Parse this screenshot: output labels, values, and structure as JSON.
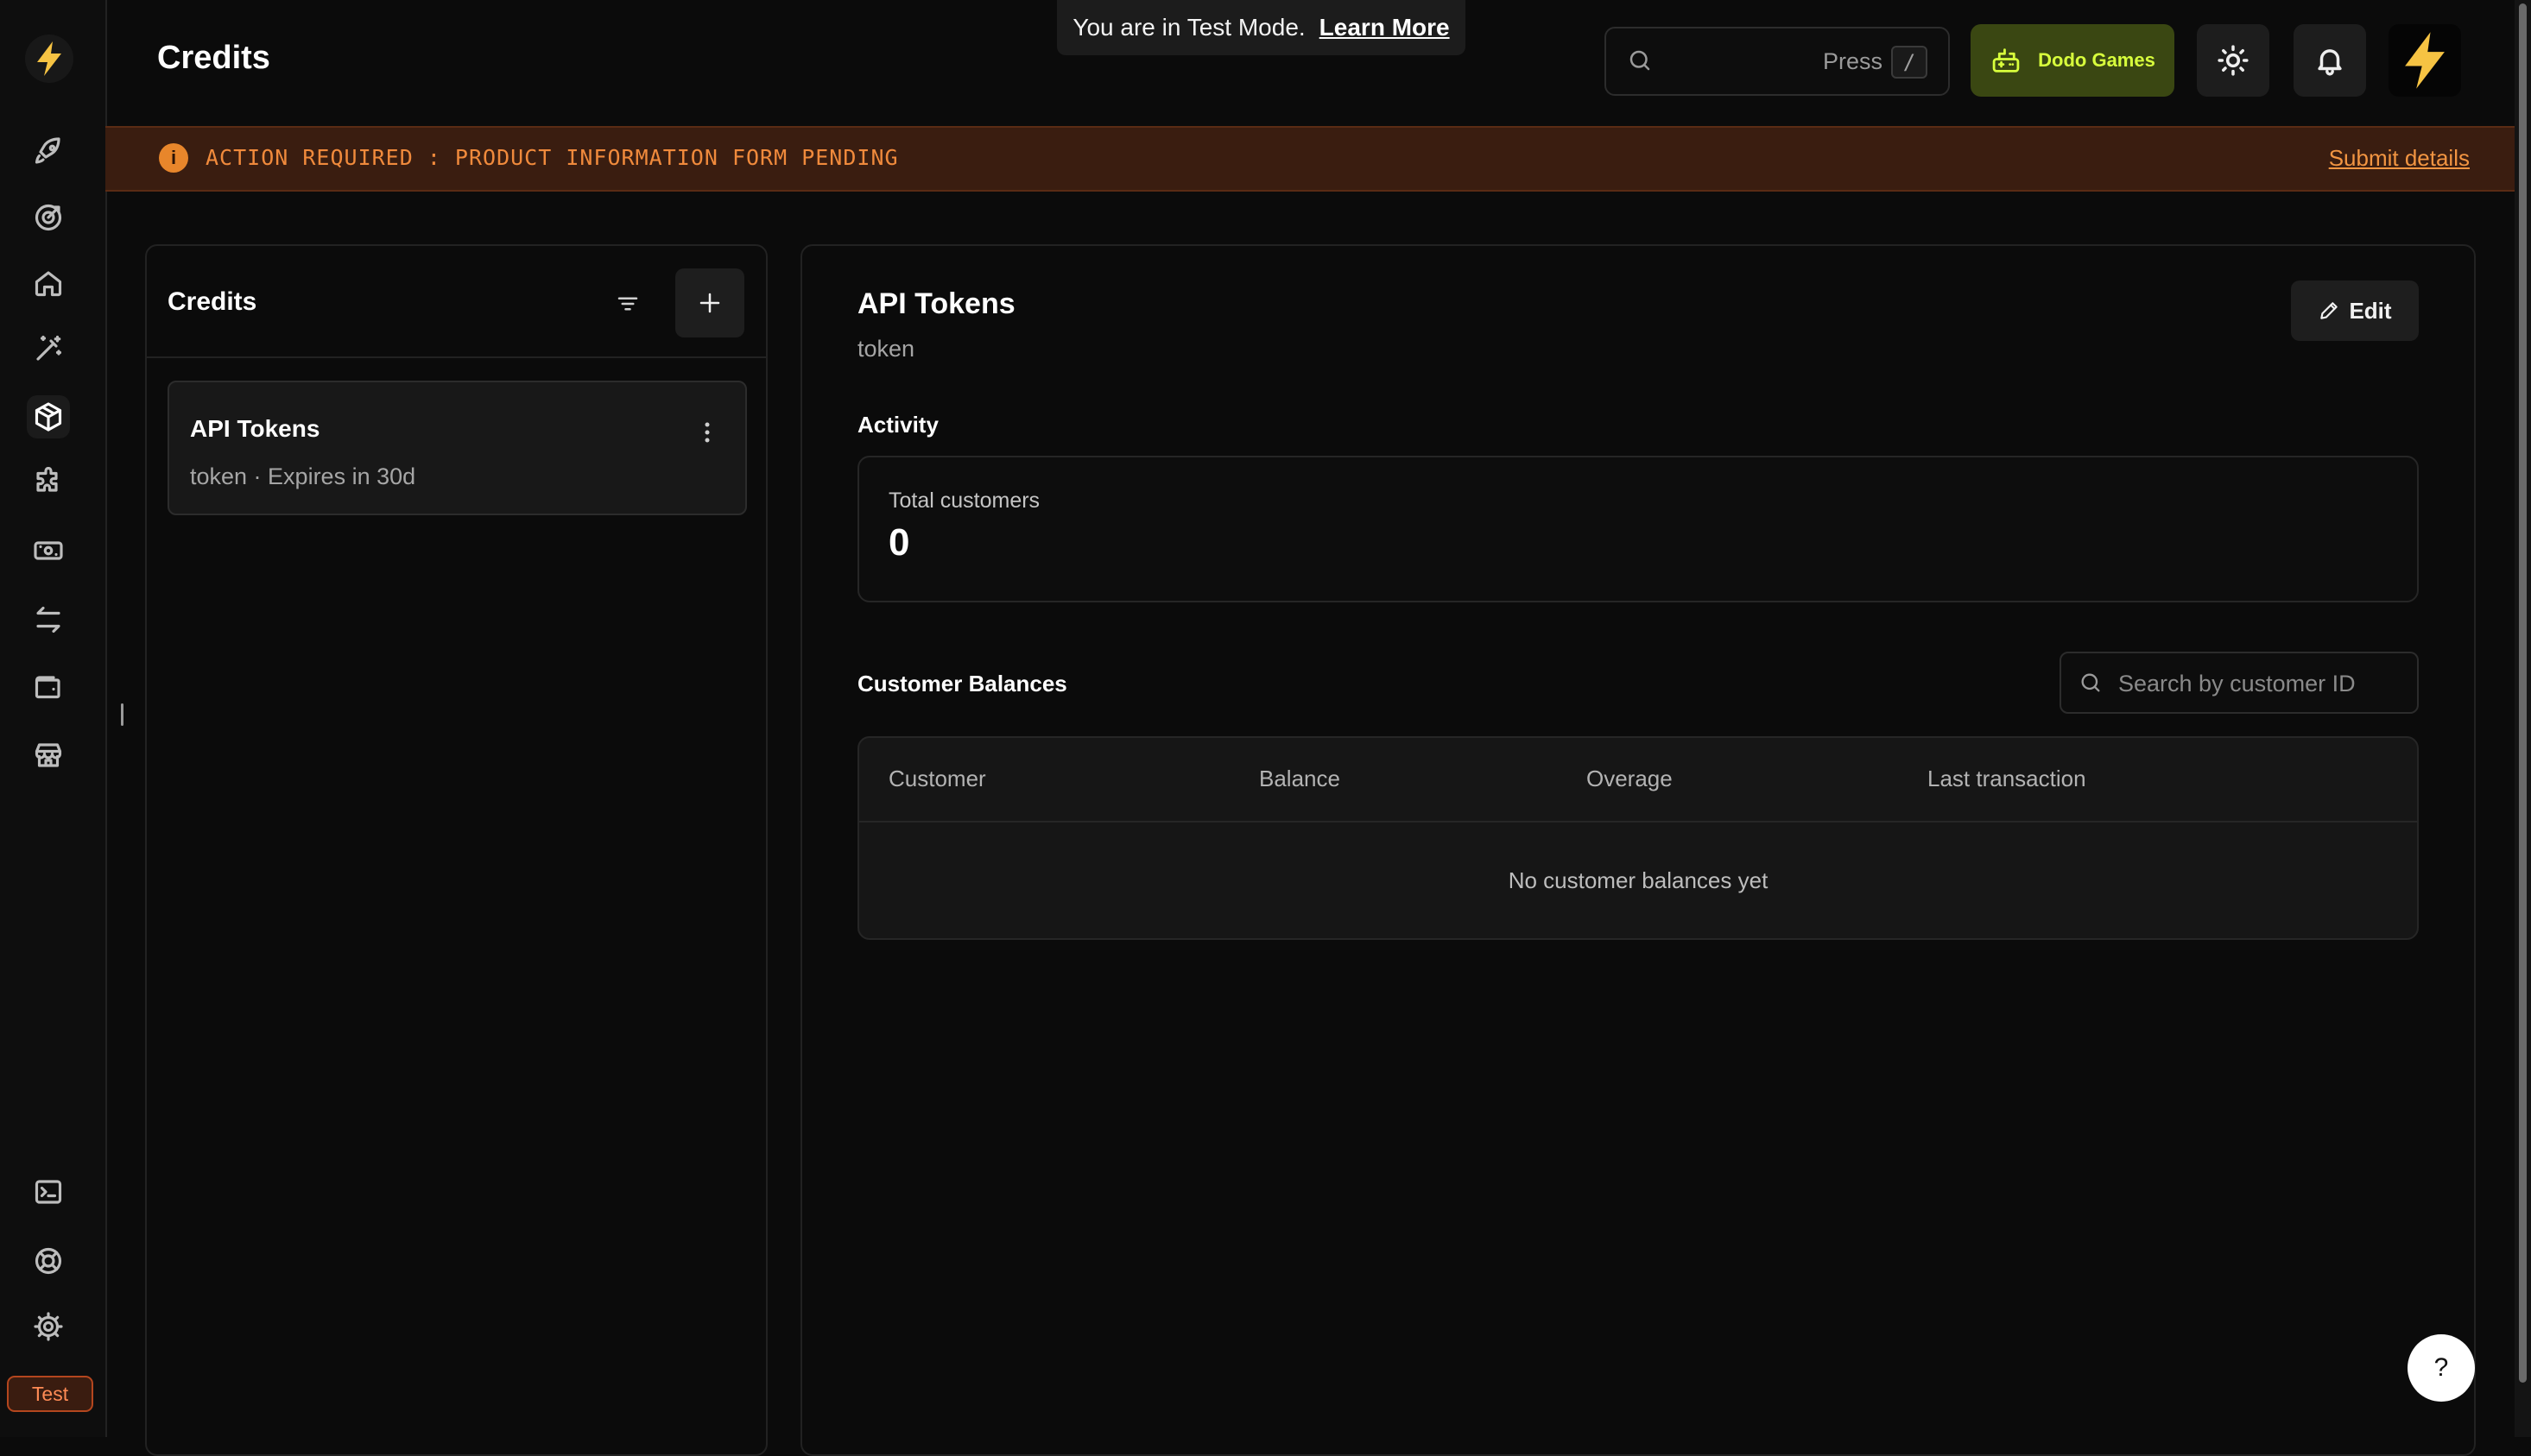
{
  "header": {
    "page_title": "Credits",
    "test_mode_text": "You are in Test Mode.",
    "test_mode_link": "Learn More",
    "search_press": "Press",
    "search_shortcut": "/",
    "brand_button_label": "Dodo Games"
  },
  "banner": {
    "message": "ACTION REQUIRED : PRODUCT INFORMATION FORM PENDING",
    "link": "Submit details",
    "color": "#f08a3c"
  },
  "sidebar": {
    "items": [
      {
        "icon": "rocket-icon"
      },
      {
        "icon": "target-icon"
      },
      {
        "icon": "home-icon"
      },
      {
        "icon": "magic-wand-icon"
      },
      {
        "icon": "box-icon",
        "active": true
      },
      {
        "icon": "puzzle-icon"
      },
      {
        "icon": "money-icon"
      },
      {
        "icon": "transfer-icon"
      },
      {
        "icon": "wallet-icon"
      },
      {
        "icon": "store-icon"
      }
    ],
    "bottom_items": [
      {
        "icon": "terminal-icon"
      },
      {
        "icon": "lifebuoy-icon"
      },
      {
        "icon": "gear-icon"
      }
    ],
    "mode_badge": "Test"
  },
  "credits_list": {
    "title": "Credits",
    "items": [
      {
        "name": "API Tokens",
        "meta": "token · Expires in 30d"
      }
    ]
  },
  "detail": {
    "title": "API Tokens",
    "subtitle": "token",
    "edit_label": "Edit",
    "activity_label": "Activity",
    "total_customers_label": "Total customers",
    "total_customers_value": "0",
    "balances_label": "Customer Balances",
    "search_placeholder": "Search by customer ID",
    "table": {
      "columns": [
        "Customer",
        "Balance",
        "Overage",
        "Last transaction"
      ],
      "empty_text": "No customer balances yet"
    }
  },
  "help_label": "?"
}
